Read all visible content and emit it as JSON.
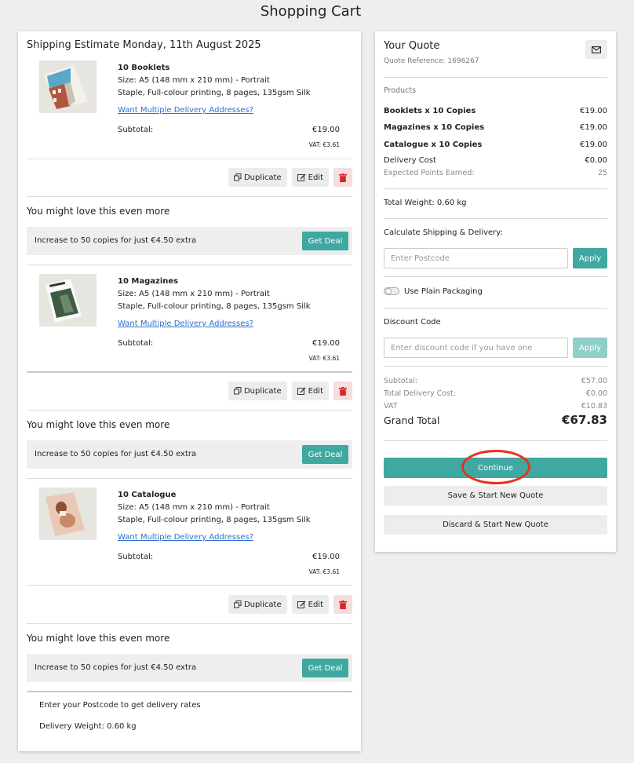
{
  "page": {
    "title": "Shopping Cart"
  },
  "cart": {
    "shipping_title": "Shipping Estimate Monday, 11th August 2025",
    "products": [
      {
        "name": "10 Booklets",
        "size": "Size: A5 (148 mm x 210 mm) - Portrait",
        "spec": "Staple, Full-colour printing, 8 pages, 135gsm Silk",
        "link": "Want Multiple Delivery Addresses?",
        "subtotal_label": "Subtotal:",
        "subtotal": "€19.00",
        "vat": "VAT: €3.61",
        "thumbnail": "booklet-building-image"
      },
      {
        "name": "10 Magazines",
        "size": "Size: A5 (148 mm x 210 mm) - Portrait",
        "spec": "Staple, Full-colour printing, 8 pages, 135gsm Silk",
        "link": "Want Multiple Delivery Addresses?",
        "subtotal_label": "Subtotal:",
        "subtotal": "€19.00",
        "vat": "VAT: €3.61",
        "thumbnail": "magazine-forest-image"
      },
      {
        "name": "10 Catalogue",
        "size": "Size: A5 (148 mm x 210 mm) - Portrait",
        "spec": "Staple, Full-colour printing, 8 pages, 135gsm Silk",
        "link": "Want Multiple Delivery Addresses?",
        "subtotal_label": "Subtotal:",
        "subtotal": "€19.00",
        "vat": "VAT: €3.61",
        "thumbnail": "catalogue-portrait-image"
      }
    ],
    "actions": {
      "duplicate": "Duplicate",
      "edit": "Edit"
    },
    "upsell": {
      "heading": "You might love this even more",
      "text": "Increase to 50 copies for just €4.50 extra",
      "button": "Get Deal"
    },
    "footer": {
      "postcode_note": "Enter your Postcode to get delivery rates",
      "weight": "Delivery Weight: 0.60 kg"
    }
  },
  "quote": {
    "title": "Your Quote",
    "reference": "Quote Reference: 1696267",
    "products_label": "Products",
    "items": [
      {
        "label": "Booklets x 10 Copies",
        "value": "€19.00"
      },
      {
        "label": "Magazines x 10 Copies",
        "value": "€19.00"
      },
      {
        "label": "Catalogue x 10 Copies",
        "value": "€19.00"
      }
    ],
    "delivery_cost_label": "Delivery Cost",
    "delivery_cost": "€0.00",
    "points_label": "Expected Points Earned:",
    "points": "25",
    "total_weight": "Total Weight: 0.60 kg",
    "shipping_label": "Calculate Shipping & Delivery:",
    "postcode_placeholder": "Enter Postcode",
    "apply": "Apply",
    "plain_packaging": "Use Plain Packaging",
    "discount_label": "Discount Code",
    "discount_placeholder": "Enter discount code if you have one",
    "subtotal_label": "Subtotal:",
    "subtotal": "€57.00",
    "total_delivery_label": "Total Delivery Cost:",
    "total_delivery": "€0.00",
    "vat_label": "VAT",
    "vat": "€10.83",
    "grand_total_label": "Grand Total",
    "grand_total": "€67.83",
    "continue": "Continue",
    "save_new": "Save & Start New Quote",
    "discard_new": "Discard & Start New Quote"
  },
  "colors": {
    "accent": "#3fa8a0",
    "link": "#2a6fd0",
    "highlight": "#e8311f"
  }
}
